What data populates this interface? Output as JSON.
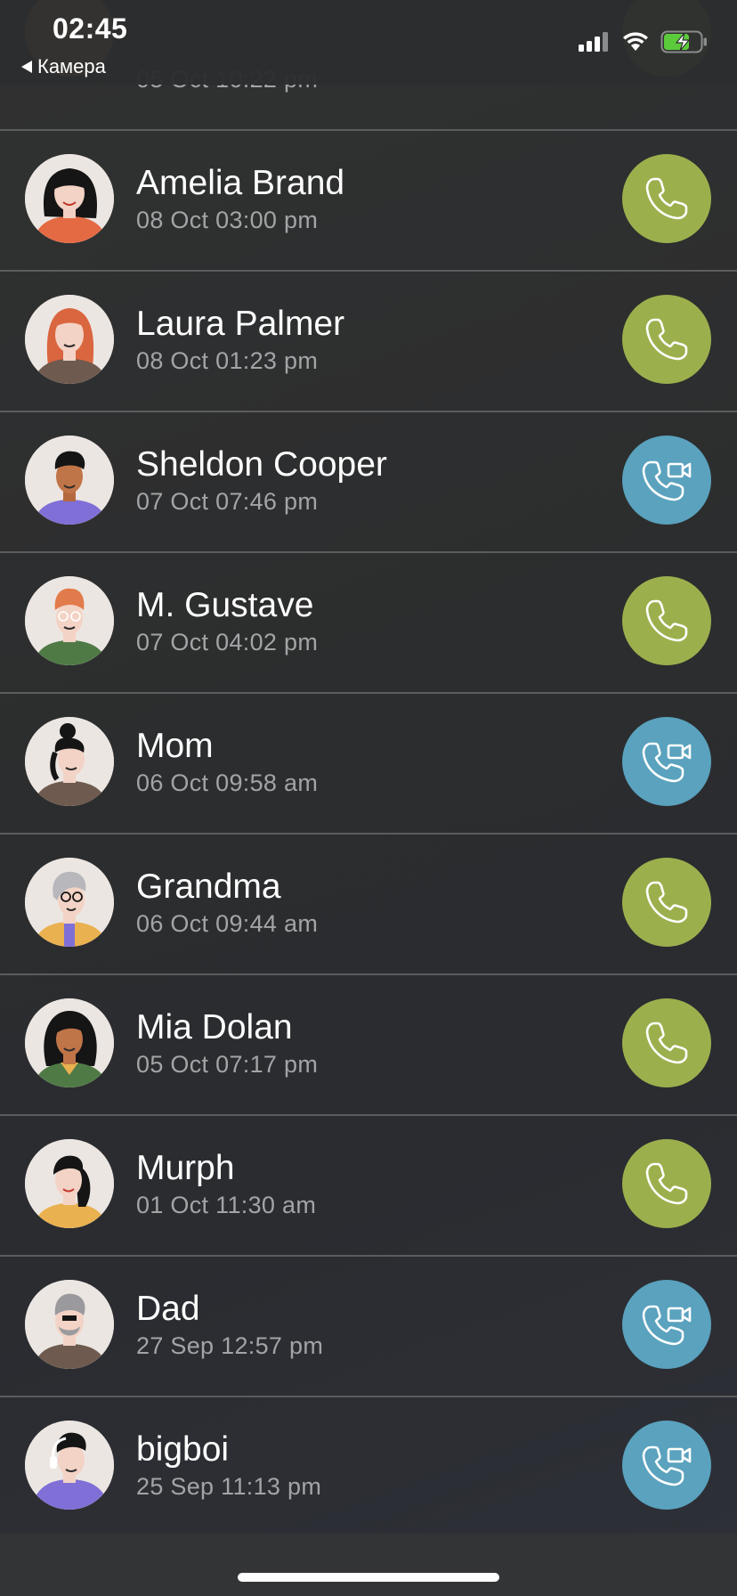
{
  "status_bar": {
    "time": "02:45",
    "back_label": "Камера"
  },
  "partial_row": {
    "time_fragment": "05 Oct 10:22 pm",
    "call_type": "voice"
  },
  "calls": [
    {
      "name": "Amelia Brand",
      "time": "08 Oct 03:00 pm",
      "call_type": "voice",
      "avatar": "woman-dark-hair-orange-top"
    },
    {
      "name": "Laura Palmer",
      "time": "08 Oct 01:23 pm",
      "call_type": "voice",
      "avatar": "woman-red-hair-brown-top"
    },
    {
      "name": "Sheldon Cooper",
      "time": "07 Oct 07:46 pm",
      "call_type": "video",
      "avatar": "man-dark-hair-purple-top"
    },
    {
      "name": "M. Gustave",
      "time": "07 Oct 04:02 pm",
      "call_type": "voice",
      "avatar": "man-ginger-hair-green-top"
    },
    {
      "name": "Mom",
      "time": "06 Oct 09:58 am",
      "call_type": "video",
      "avatar": "woman-bun-brown-top"
    },
    {
      "name": "Grandma",
      "time": "06 Oct 09:44 am",
      "call_type": "voice",
      "avatar": "old-woman-glasses-yellow-top"
    },
    {
      "name": "Mia Dolan",
      "time": "05 Oct 07:17 pm",
      "call_type": "voice",
      "avatar": "woman-curly-hair-green-top"
    },
    {
      "name": "Murph",
      "time": "01 Oct 11:30 am",
      "call_type": "voice",
      "avatar": "woman-dark-hair-yellow-top"
    },
    {
      "name": "Dad",
      "time": "27 Sep 12:57 pm",
      "call_type": "video",
      "avatar": "old-man-grey-hair-brown-top"
    },
    {
      "name": "bigboi",
      "time": "25 Sep 11:13 pm",
      "call_type": "video",
      "avatar": "man-headphones-purple-hoodie"
    }
  ],
  "colors": {
    "voice_button": "#9bb04d",
    "video_button": "#5aa2be",
    "background": "#2e2f31",
    "divider": "#5b5c5e",
    "secondary_text": "#a3a4a6"
  },
  "icons": {
    "voice": "phone-icon",
    "video": "video-call-icon"
  }
}
